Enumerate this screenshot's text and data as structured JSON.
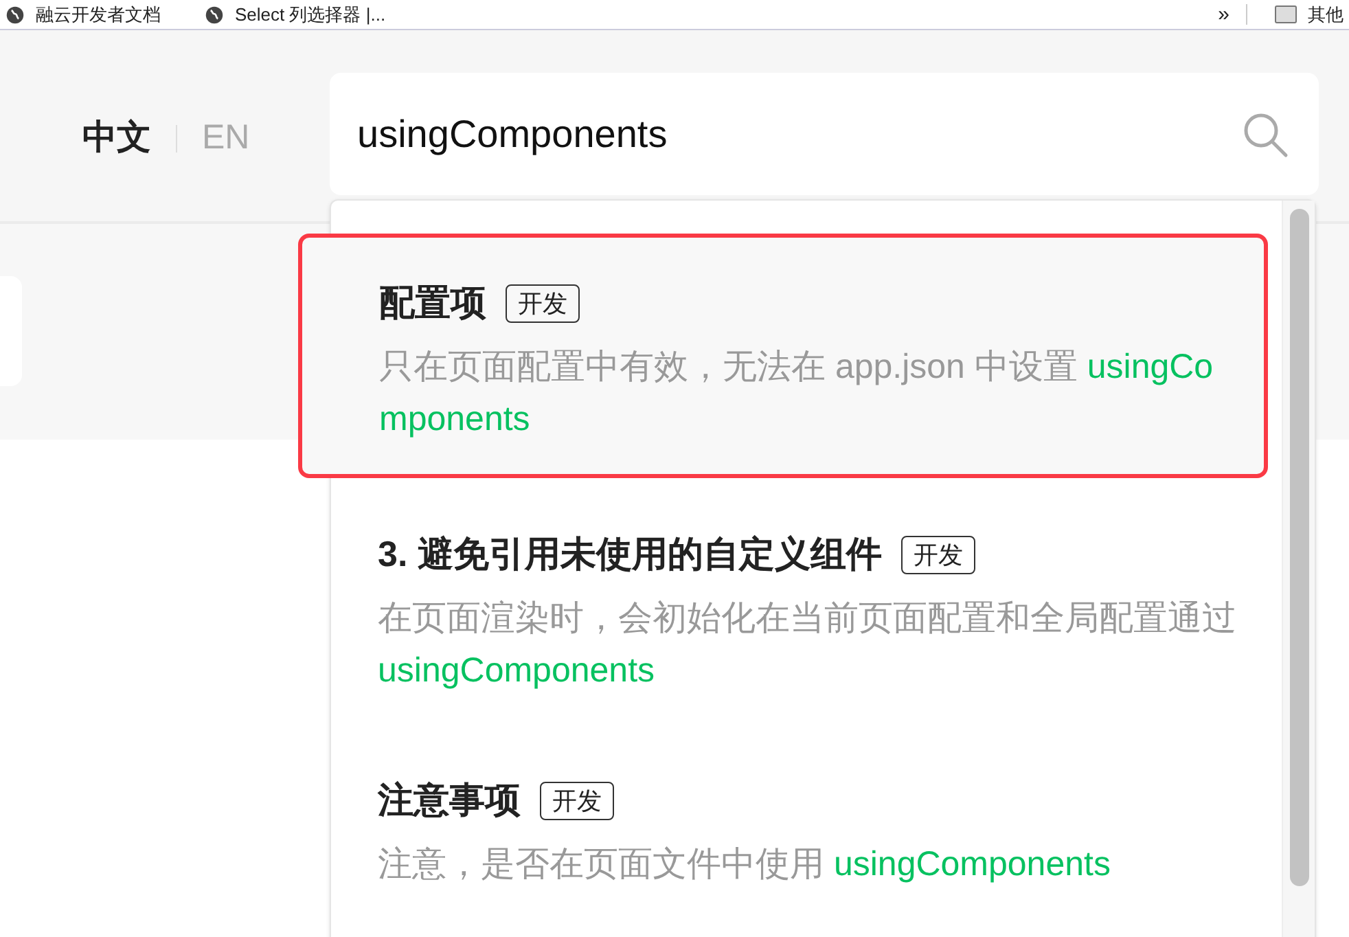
{
  "bookmarks": [
    {
      "label": "融云开发者文档",
      "kind": "site"
    },
    {
      "label": "Select 列选择器 |...",
      "kind": "site"
    },
    {
      "label": "其他",
      "kind": "folder"
    }
  ],
  "bookmarks_overflow": "»",
  "languages": [
    {
      "label": "中文",
      "selected": true
    },
    {
      "label": "EN",
      "selected": false
    }
  ],
  "search": {
    "value": "usingComponents"
  },
  "results": [
    {
      "title": "配置项",
      "tag": "开发",
      "selected": true,
      "description": [
        {
          "text": "只在页面配置中有效，无法在 app.json 中设置 ",
          "highlight": false
        },
        {
          "text": "usingComponents",
          "highlight": true
        }
      ]
    },
    {
      "title": "3. 避免引用未使用的自定义组件",
      "tag": "开发",
      "selected": false,
      "description": [
        {
          "text": "在页面渲染时，会初始化在当前页面配置和全局配置通过 ",
          "highlight": false
        },
        {
          "text": "usingComponents",
          "highlight": true
        }
      ]
    },
    {
      "title": "注意事项",
      "tag": "开发",
      "selected": false,
      "description": [
        {
          "text": "注意，是否在页面文件中使用 ",
          "highlight": false
        },
        {
          "text": "usingComponents",
          "highlight": true
        }
      ]
    }
  ]
}
